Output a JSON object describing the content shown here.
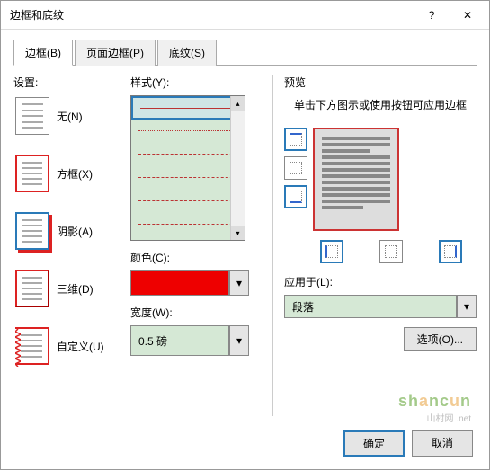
{
  "title": "边框和底纹",
  "tabs": [
    {
      "label": "边框(B)",
      "active": true
    },
    {
      "label": "页面边框(P)",
      "active": false
    },
    {
      "label": "底纹(S)",
      "active": false
    }
  ],
  "settings": {
    "label": "设置:",
    "items": [
      {
        "label": "无(N)",
        "type": "none",
        "selected": false
      },
      {
        "label": "方框(X)",
        "type": "box",
        "selected": false
      },
      {
        "label": "阴影(A)",
        "type": "shadow",
        "selected": true
      },
      {
        "label": "三维(D)",
        "type": "3d",
        "selected": false
      },
      {
        "label": "自定义(U)",
        "type": "custom",
        "selected": false
      }
    ]
  },
  "style": {
    "label": "样式(Y):",
    "selected_index": 0
  },
  "color": {
    "label": "颜色(C):",
    "value": "#e00000"
  },
  "width": {
    "label": "宽度(W):",
    "value": "0.5 磅"
  },
  "preview": {
    "label": "预览",
    "hint": "单击下方图示或使用按钮可应用边框"
  },
  "apply_to": {
    "label": "应用于(L):",
    "value": "段落"
  },
  "options_button": "选项(O)...",
  "ok_button": "确定",
  "cancel_button": "取消",
  "watermark": {
    "text": "shancun",
    "domain": ".net",
    "sub": "山村网"
  }
}
